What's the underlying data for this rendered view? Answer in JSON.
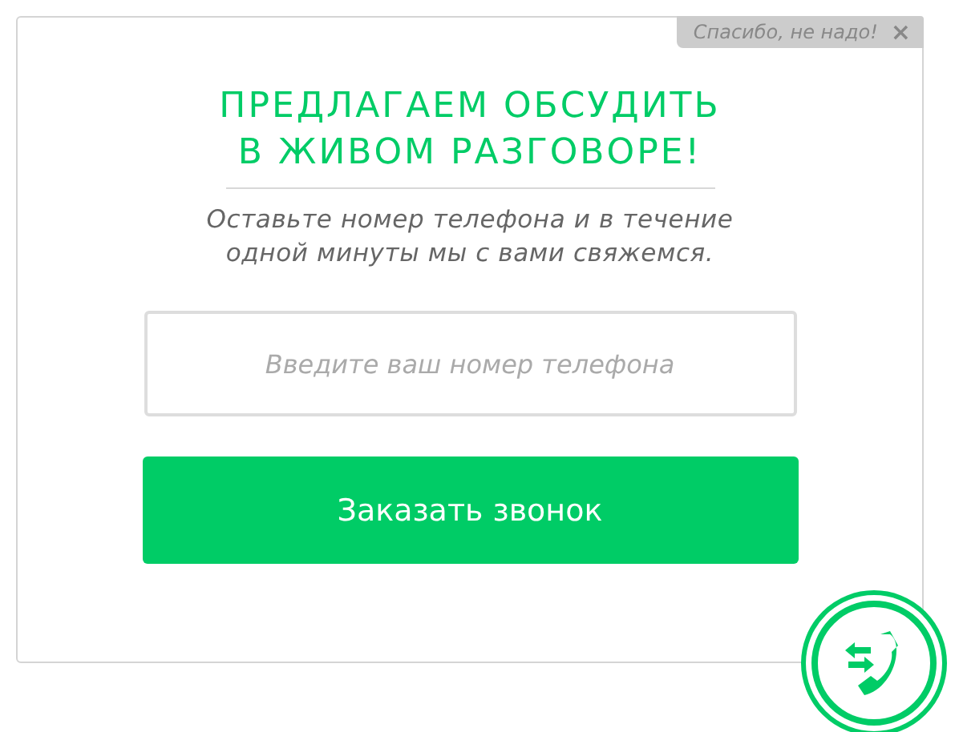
{
  "dismiss": {
    "label": "Спасибо, не надо!",
    "close": "×"
  },
  "title": "ПРЕДЛАГАЕМ ОБСУДИТЬ В ЖИВОМ РАЗГОВОРЕ!",
  "subtitle": "Оставьте номер телефона и в течение одной минуты мы с вами свяжемся.",
  "phone_field": {
    "placeholder": "Введите ваш номер телефона"
  },
  "submit_button": "Заказать звонок"
}
